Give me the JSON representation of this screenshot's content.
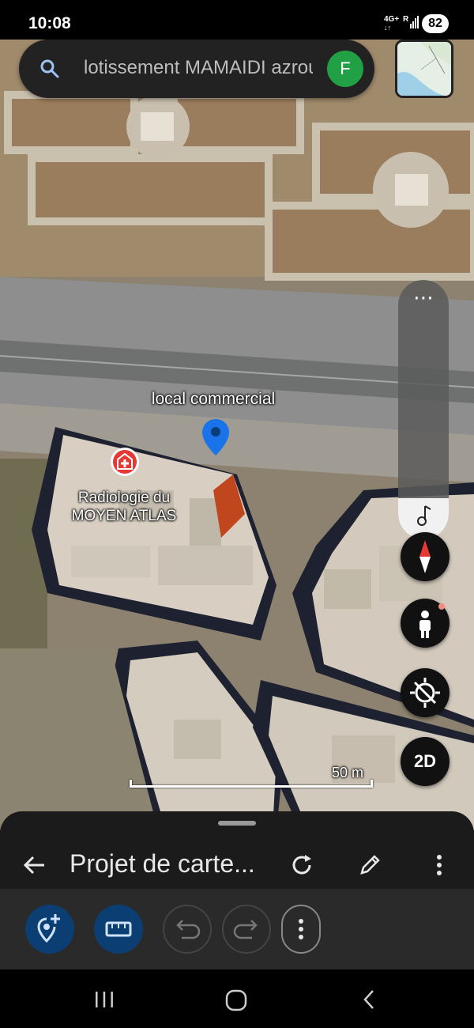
{
  "status_bar": {
    "time": "10:08",
    "network": "4G+",
    "signal": "R",
    "battery": "82"
  },
  "search": {
    "query": "lotissement MAMAIDI azrou",
    "account_initial": "F",
    "account_color": "#22a045"
  },
  "map": {
    "pin_label": "local commercial",
    "poi_label_line1": "Radiologie du",
    "poi_label_line2": "MOYEN ATLAS",
    "scale_label": "50 m",
    "pin_color": "#1a73e8",
    "poi_color": "#e53935"
  },
  "controls": {
    "more_label": "⋯",
    "view_mode_label": "2D"
  },
  "sheet": {
    "title": "Projet de carte..."
  },
  "icons": [
    "search-icon",
    "layers-icon",
    "more-icon",
    "audio-icon",
    "compass-icon",
    "street-view-icon",
    "location-icon",
    "back-arrow-icon",
    "refresh-icon",
    "edit-pencil-icon",
    "overflow-menu-icon",
    "add-placemark-icon",
    "measure-icon",
    "undo-icon",
    "redo-icon",
    "nav-recents-icon",
    "nav-home-icon",
    "nav-back-icon"
  ]
}
